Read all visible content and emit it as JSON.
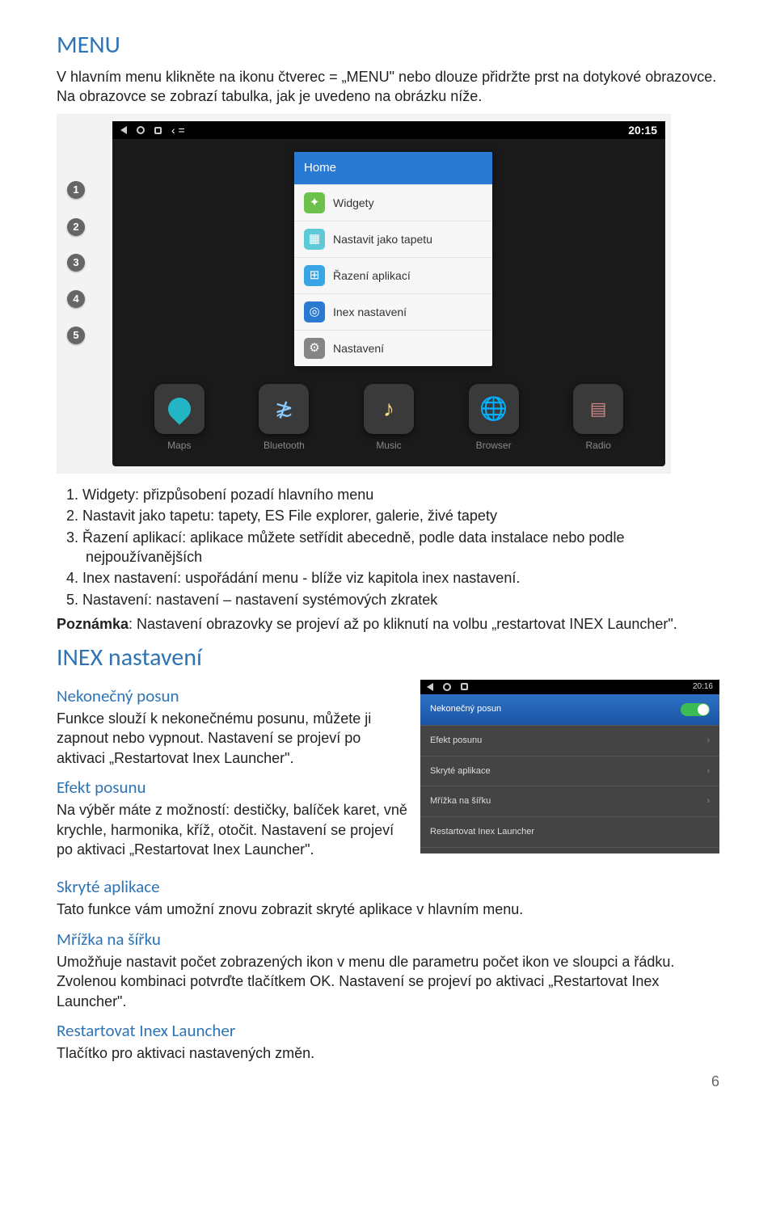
{
  "sections": {
    "menu": {
      "title": "MENU",
      "intro": "V hlavním menu klikněte na ikonu čtverec = „MENU\" nebo dlouze přidržte prst na dotykové obrazovce. Na obrazovce se zobrazí tabulka, jak je uvedeno na obrázku níže."
    },
    "list": {
      "item1": "1.  Widgety: přizpůsobení pozadí hlavního menu",
      "item2": "2.  Nastavit jako tapetu: tapety, ES File explorer, galerie, živé tapety",
      "item3": "3.  Řazení aplikací: aplikace můžete setřídit abecedně, podle data instalace nebo podle nejpoužívanějších",
      "item4": "4.  Inex nastavení: uspořádání menu - blíže viz kapitola inex nastavení.",
      "item5": "5.  Nastavení: nastavení – nastavení systémových zkratek"
    },
    "note_label": "Poznámka",
    "note_text": ": Nastavení obrazovky se projeví až po kliknutí na volbu „restartovat INEX Launcher\".",
    "inex": {
      "title": "INEX nastavení",
      "s1_title": "Nekonečný posun",
      "s1_text": "Funkce slouží k nekonečnému posunu, můžete ji zapnout nebo vypnout. Nastavení se projeví po aktivaci „Restartovat Inex Launcher\".",
      "s2_title": "Efekt posunu",
      "s2_text": "Na výběr máte z možností: destičky, balíček karet, vně krychle, harmonika, kříž, otočit. Nastavení se projeví po aktivaci „Restartovat Inex Launcher\".",
      "s3_title": "Skryté aplikace",
      "s3_text": "Tato funkce vám umožní znovu zobrazit skryté aplikace v hlavním menu.",
      "s4_title": "Mřížka na šířku",
      "s4_text": "Umožňuje nastavit počet zobrazených ikon v menu dle parametru počet ikon ve sloupci a řádku. Zvolenou kombinaci potvrďte tlačítkem OK. Nastavení se projeví po aktivaci „Restartovat Inex Launcher\".",
      "s5_title": "Restartovat Inex Launcher",
      "s5_text": "Tlačítko pro aktivaci nastavených změn."
    }
  },
  "screenshot1": {
    "time": "20:15",
    "nav_back": "‹ =",
    "menu_header": "Home",
    "items": {
      "i1": "Widgety",
      "i2": "Nastavit jako tapetu",
      "i3": "Řazení aplikací",
      "i4": "Inex nastavení",
      "i5": "Nastavení"
    },
    "badges": {
      "b1": "1",
      "b2": "2",
      "b3": "3",
      "b4": "4",
      "b5": "5"
    },
    "dock": {
      "d1": "Maps",
      "d2": "Bluetooth",
      "d3": "Music",
      "d4": "Browser",
      "d5": "Radio"
    }
  },
  "screenshot2": {
    "time": "20:16",
    "rows": {
      "r1": "Nekonečný posun",
      "r2": "Efekt posunu",
      "r3": "Skryté aplikace",
      "r4": "Mřížka na šířku",
      "r5": "Restartovat Inex Launcher"
    }
  },
  "page_number": "6"
}
